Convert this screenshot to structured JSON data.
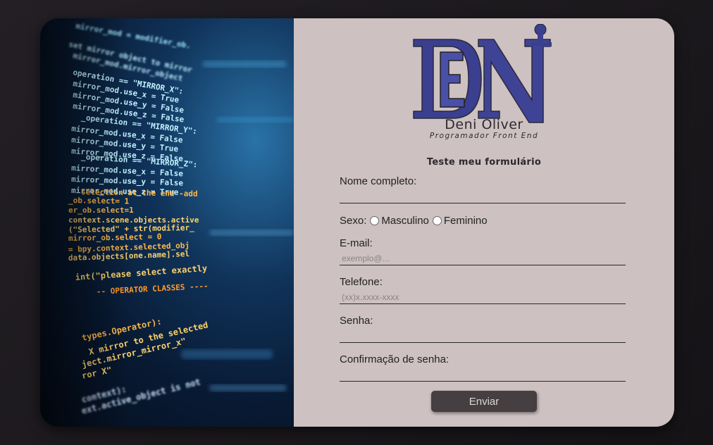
{
  "brand": {
    "logo_letters": "DN",
    "name": "Deni Oliver",
    "subtitle": "Programador Front End",
    "logo_color": "#3b3f8f"
  },
  "form": {
    "title": "Teste meu formulário",
    "fields": [
      {
        "label": "Nome completo:",
        "placeholder": ""
      },
      {
        "label": "E-mail:",
        "placeholder": "exemplo@..."
      },
      {
        "label": "Telefone:",
        "placeholder": "(xx)x.xxxx-xxxx"
      },
      {
        "label": "Senha:",
        "placeholder": ""
      },
      {
        "label": "Confirmação de senha:",
        "placeholder": ""
      }
    ],
    "sexo": {
      "label": "Sexo:",
      "options": [
        "Masculino",
        "Feminino"
      ]
    },
    "submit_label": "Enviar"
  },
  "code_image": {
    "lines": [
      "mirror_mod = modifier_ob.",
      "set mirror object to mirror",
      "mirror_mod.mirror_object",
      "operation == \"MIRROR_X\":",
      "mirror_mod.use_x = True",
      "mirror_mod.use_y = False",
      "mirror_mod.use_z = False",
      "_operation == \"MIRROR_Y\":",
      "mirror_mod.use_x = False",
      "mirror_mod.use_y = True",
      "mirror_mod.use_z = False",
      "_operation == \"MIRROR_Z\":",
      "mirror_mod.use_x = False",
      "mirror_mod.use_y = False",
      "mirror_mod.use_z = True",
      "selection at the end -add",
      "_ob.select= 1",
      "er_ob.select=1",
      "context.scene.objects.active",
      "(\"Selected\" + str(modifier_",
      "mirror_ob.select = 0",
      "= bpy.context.selected_obj",
      "data.objects[one.name].sel",
      "int(\"please select exactly",
      "-- OPERATOR CLASSES ----",
      "types.Operator):",
      "X mirror to the selected",
      "ject.mirror_mirror_x\"",
      "ror X\"",
      "context):",
      "ext.active_object is not"
    ]
  }
}
